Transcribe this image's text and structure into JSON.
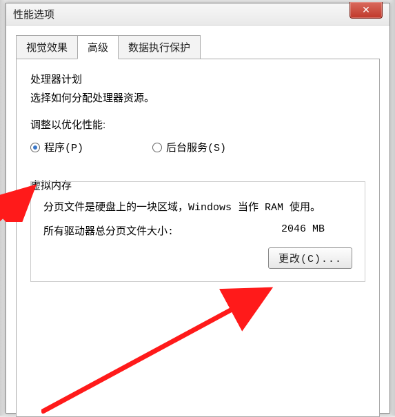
{
  "window": {
    "title": "性能选项"
  },
  "tabs": {
    "visual": "视觉效果",
    "advanced": "高级",
    "dep": "数据执行保护"
  },
  "cpu": {
    "title": "处理器计划",
    "desc": "选择如何分配处理器资源。",
    "adjust_label": "调整以优化性能:",
    "opt_programs": "程序(P)",
    "opt_services": "后台服务(S)"
  },
  "vm": {
    "title": "虚拟内存",
    "desc": "分页文件是硬盘上的一块区域，Windows 当作 RAM 使用。",
    "total_label": "所有驱动器总分页文件大小:",
    "total_value": "2046 MB",
    "change_btn": "更改(C)..."
  }
}
